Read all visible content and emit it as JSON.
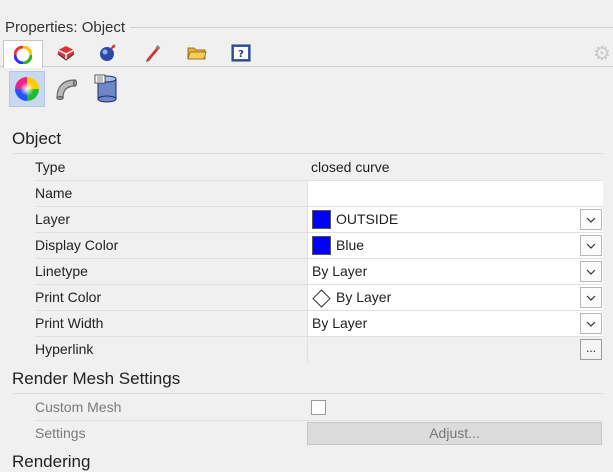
{
  "panel": {
    "title": "Properties: Object"
  },
  "tabs": [
    {
      "name": "object",
      "icon": "color-wheel-icon",
      "active": true
    },
    {
      "name": "material",
      "icon": "material-icon"
    },
    {
      "name": "render",
      "icon": "render-sphere-icon"
    },
    {
      "name": "texture",
      "icon": "texture-pen-icon"
    },
    {
      "name": "files",
      "icon": "folder-icon"
    },
    {
      "name": "help",
      "icon": "help-icon"
    }
  ],
  "subtabs": [
    {
      "icon": "color-wheel-icon",
      "active": true
    },
    {
      "icon": "curve-piping-icon"
    },
    {
      "icon": "database-cylinder-icon"
    }
  ],
  "object": {
    "heading": "Object",
    "type_label": "Type",
    "type_value": "closed curve",
    "name_label": "Name",
    "name_value": "",
    "layer_label": "Layer",
    "layer_value": "OUTSIDE",
    "layer_color": "#0000ff",
    "display_color_label": "Display Color",
    "display_color_value": "Blue",
    "display_color_color": "#0000ff",
    "linetype_label": "Linetype",
    "linetype_value": "By Layer",
    "print_color_label": "Print Color",
    "print_color_value": "By Layer",
    "print_width_label": "Print Width",
    "print_width_value": "By Layer",
    "hyperlink_label": "Hyperlink",
    "hyperlink_button": "..."
  },
  "render_mesh": {
    "heading": "Render Mesh Settings",
    "custom_mesh_label": "Custom Mesh",
    "custom_mesh_checked": false,
    "settings_label": "Settings",
    "adjust_button": "Adjust..."
  },
  "rendering": {
    "heading": "Rendering"
  }
}
